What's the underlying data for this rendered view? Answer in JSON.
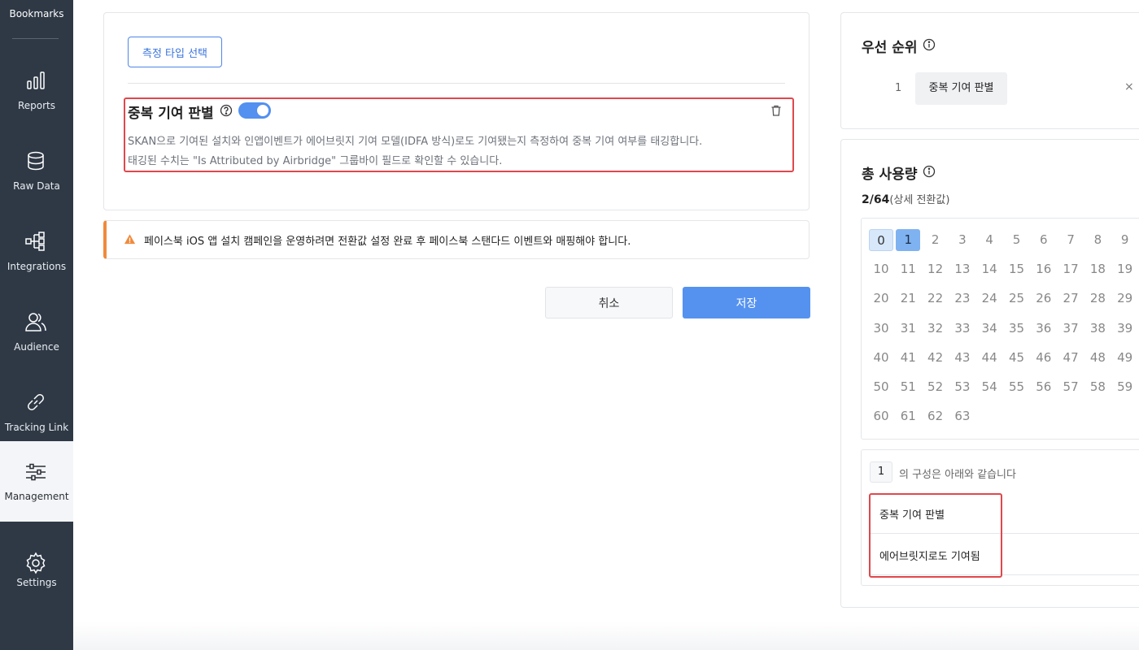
{
  "sidebar": {
    "bookmarks_label": "Bookmarks",
    "items": [
      {
        "label": "Reports",
        "icon": "bar-chart-icon"
      },
      {
        "label": "Raw Data",
        "icon": "database-icon"
      },
      {
        "label": "Integrations",
        "icon": "integrations-icon"
      },
      {
        "label": "Audience",
        "icon": "audience-icon"
      },
      {
        "label": "Tracking Link",
        "icon": "link-icon"
      },
      {
        "label": "Management",
        "icon": "sliders-icon",
        "active": true
      },
      {
        "label": "Settings",
        "icon": "gear-icon"
      }
    ]
  },
  "main": {
    "type_select_button": "측정 타입 선택",
    "dup_title": "중복 기여 판별",
    "dup_toggle_on": true,
    "dup_desc_1": "SKAN으로 기여된 설치와 인앱이벤트가 에어브릿지 기여 모델(IDFA 방식)로도 기여됐는지 측정하여 중복 기여 여부를 태깅합니다.",
    "dup_desc_2": "태깅된 수치는 \"Is Attributed by Airbridge\" 그룹바이 필드로 확인할 수 있습니다.",
    "warning": "페이스북 iOS 앱 설치 캠페인을 운영하려면 전환값 설정 완료 후 페이스북 스탠다드 이벤트와 매핑해야 합니다.",
    "cancel_label": "취소",
    "save_label": "저장"
  },
  "priority": {
    "title": "우선 순위",
    "items": [
      {
        "num": "1",
        "label": "중복 기여 판별",
        "remove": "×"
      }
    ]
  },
  "usage": {
    "title": "총 사용량",
    "count": "2/64",
    "count_suffix": "(상세 전환값)",
    "selected": [
      0,
      1
    ],
    "grid_count": 64,
    "config_num": "1",
    "config_text": "의 구성은 아래와 같습니다",
    "config_rows": [
      "중복 기여 판별",
      "에어브릿지로도 기여됨"
    ]
  },
  "colors": {
    "sidebar_bg": "#2f3946",
    "accent": "#5592f0",
    "highlight_red": "#e0474c",
    "warning_orange": "#f08a3c"
  }
}
